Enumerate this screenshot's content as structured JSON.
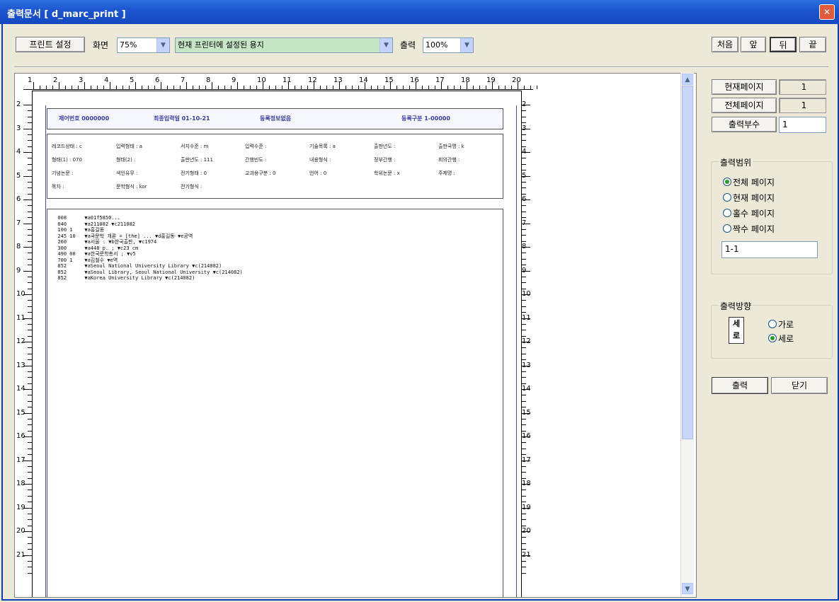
{
  "window": {
    "title": "출력문서 [ d_marc_print ]"
  },
  "toolbar": {
    "printer_settings": "프린트 설정",
    "screen_label": "화면",
    "zoom_value": "75%",
    "paper_value": "현재 프린터에 설정된 용지",
    "output_label": "출력",
    "output_zoom_value": "100%",
    "nav_first": "처음",
    "nav_prev": "앞",
    "nav_next": "뒤",
    "nav_last": "끝"
  },
  "ruler": {
    "h_numbers": [
      "1",
      "2",
      "3",
      "4",
      "5",
      "6",
      "7",
      "8",
      "9",
      "10",
      "11",
      "12",
      "13",
      "14",
      "15",
      "16",
      "17",
      "18",
      "19",
      "20"
    ],
    "v_numbers": [
      "2",
      "3",
      "4",
      "5",
      "6",
      "7",
      "8",
      "9",
      "10",
      "11",
      "12",
      "13",
      "14",
      "15",
      "16",
      "17",
      "18",
      "19",
      "20",
      "21"
    ]
  },
  "document": {
    "header": {
      "control_no": "제어번호 0000000",
      "date": "최종입력일 01-10-21",
      "status": "등록정보없음",
      "type": "등록구분 1-00000"
    },
    "grid": [
      [
        "레코드상태 : c",
        "입력형태 : a",
        "서지수준 : m",
        "입력수준 :",
        "기술목록 : a",
        "출판년도 :",
        "출판국명 : k"
      ],
      [
        "형태(1) : 070",
        "형태(2) :",
        "출판년도 : 111",
        "간행빈도 :",
        "내용형식 :",
        "정부간행 :",
        "회의간행 :"
      ],
      [
        "기념논문 :",
        "색인유무 :",
        "전기형태 : 0",
        "교과용구분 : 0",
        "언어 : 0",
        "학위논문 : x",
        "주제명 :"
      ],
      [
        "목차 :",
        "문학형식 : kor",
        "전기형식 :",
        "",
        "",
        "",
        ""
      ]
    ],
    "marc_lines": [
      "  008      ▼a01f5850...",
      "  040      ▼a211082 ▼c211082",
      "  100 1    ▼a홍길동",
      "  245 10   ▼a국문학 개론 = [the] ... ▼d홍길동 ▼e공역",
      "  260      ▼a서울 : ▼b한국출판, ▼c1974",
      "  300      ▼a448 p. ; ▼c23 cm",
      "  490 00   ▼a한국문학총서 ; ▼v5",
      "  700 1    ▼a김철수 ▼e역",
      "  852      ▼aSeoul National University Library ▼c(214082)",
      "  852      ▼aSeoul Library, Seoul National University ▼c(214082)",
      "  852      ▼aKorea University Library ▼c(214082)"
    ]
  },
  "side": {
    "current_page_label": "현재페이지",
    "current_page_value": "1",
    "total_page_label": "전체페이지",
    "total_page_value": "1",
    "copies_label": "출력부수",
    "copies_value": "1",
    "range_title": "출력범위",
    "range_all": "전체 페이지",
    "range_current": "현재 페이지",
    "range_odd": "홀수 페이지",
    "range_even": "짝수 페이지",
    "range_input": "1-1",
    "direction_title": "출력방향",
    "direction_icon_text": "세로",
    "direction_landscape": "가로",
    "direction_portrait": "세로",
    "print_button": "출력",
    "close_button": "닫기"
  }
}
